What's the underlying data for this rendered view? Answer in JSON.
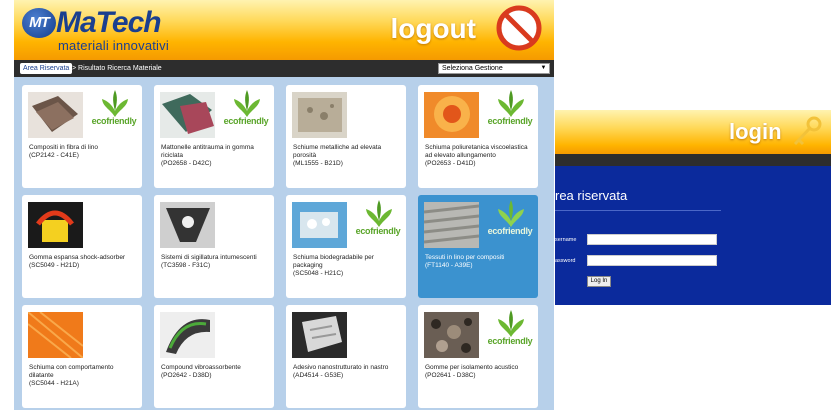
{
  "header": {
    "logo_badge": "MT",
    "logo_name": "MaTech",
    "logo_tagline": "materiali innovativi",
    "logout_label": "logout"
  },
  "breadcrumb": {
    "link": "Area Riservata",
    "current": "> Risultato Ricerca Materiale"
  },
  "select": {
    "value": "Seleziona Gestione"
  },
  "eco_label": "ecofriendly",
  "cards": [
    {
      "name": "Compositi in fibra di lino\n(CP2142 - C41E)",
      "eco": true
    },
    {
      "name": "Mattonelle antitrauma in gomma riciclata\n(PO2658 - D42C)",
      "eco": true
    },
    {
      "name": "Schiume metalliche ad elevata porosità\n(ML1555 - B21D)",
      "eco": false
    },
    {
      "name": "Schiuma poliuretanica viscoelastica ad elevato allungamento\n(PO2653 - D41D)",
      "eco": true
    },
    {
      "name": "Gomma espansa shock-adsorber\n(SC5049 - H21D)",
      "eco": false
    },
    {
      "name": "Sistemi di sigillatura intumescenti\n(TC3598 - F31C)",
      "eco": false
    },
    {
      "name": "Schiuma biodegradabile per packaging\n(SC5048 - H21C)",
      "eco": true
    },
    {
      "name": "Tessuti in lino per compositi\n(FT1140 - A39E)",
      "eco": true,
      "active": true
    },
    {
      "name": "Schiuma con comportamento dilatante\n(SC5044 - H21A)",
      "eco": false
    },
    {
      "name": "Compound vibroassorbente\n(PO2642 - D38D)",
      "eco": false
    },
    {
      "name": "Adesivo nanostrutturato in nastro\n(AD4514 - G53E)",
      "eco": false
    },
    {
      "name": "Gomme per isolamento acustico\n(PO2641 - D38C)",
      "eco": true
    }
  ],
  "login_panel": {
    "header_label": "login",
    "title": "rea riservata",
    "username_label": "sername",
    "password_label": "assword",
    "button_label": "Log In"
  },
  "colors": {
    "accent_orange": "#ffb400",
    "brand_blue": "#1a3f8f",
    "grid_bg": "#b7d0ea",
    "active_card": "#3b92cf",
    "login_bg": "#0b2a9c",
    "eco_green": "#5aa52a"
  }
}
